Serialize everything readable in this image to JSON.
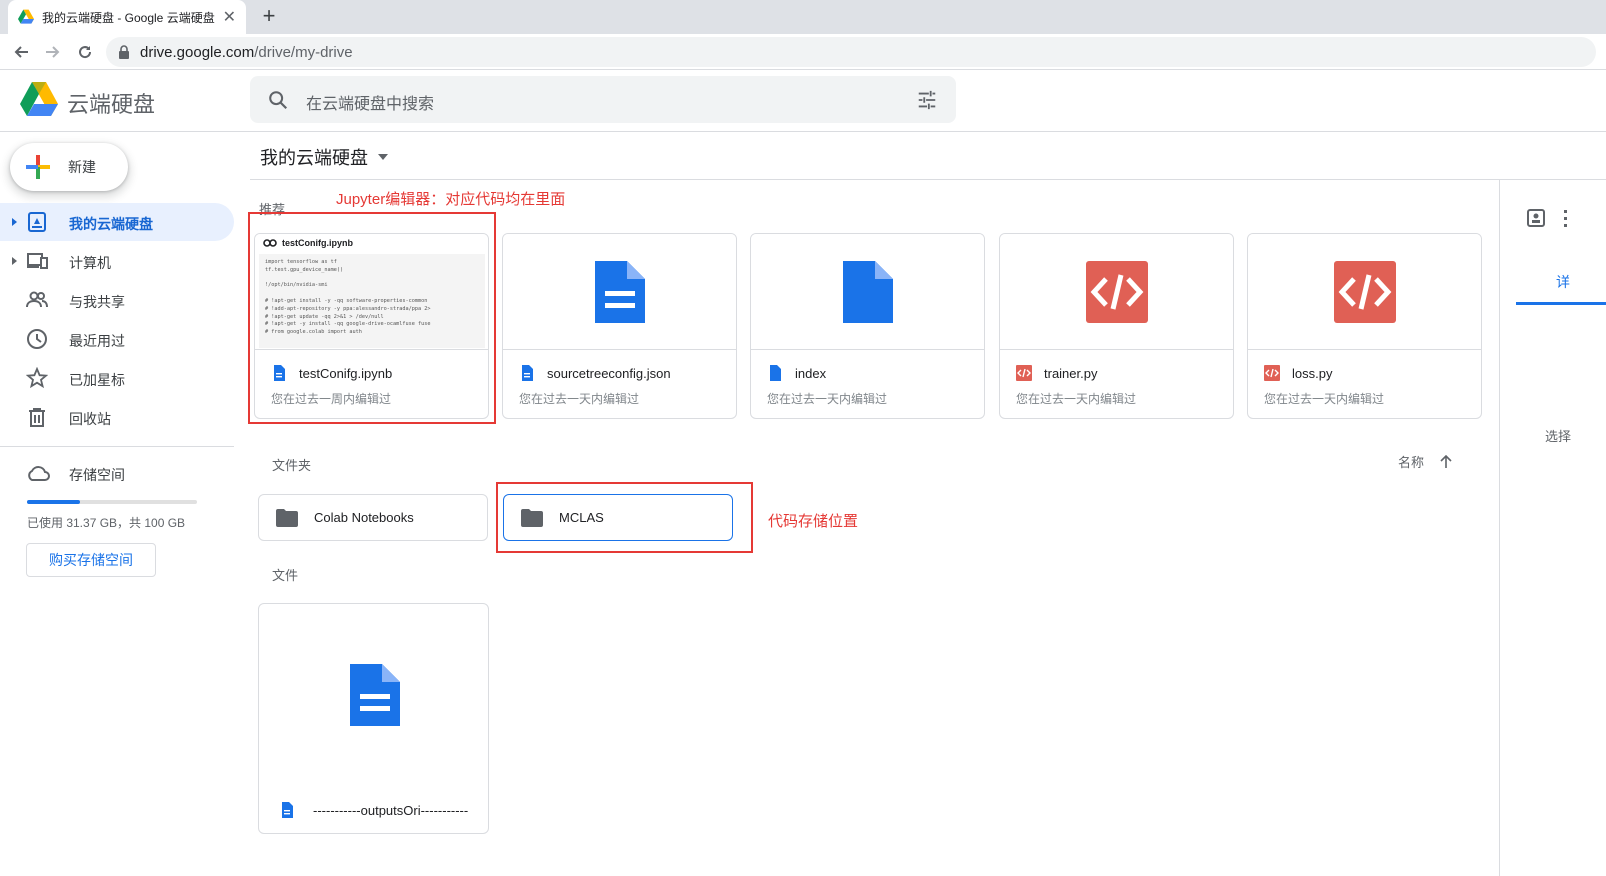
{
  "browser": {
    "tab_title": "我的云端硬盘 - Google 云端硬盘",
    "new_tab": "+",
    "close": "✕",
    "url_host": "drive.google.com",
    "url_path": "/drive/my-drive"
  },
  "header": {
    "brand": "云端硬盘",
    "search_placeholder": "在云端硬盘中搜索"
  },
  "sidebar": {
    "new_label": "新建",
    "items": [
      {
        "label": "我的云端硬盘",
        "icon": "my-drive-icon",
        "active": true
      },
      {
        "label": "计算机",
        "icon": "computer-icon"
      },
      {
        "label": "与我共享",
        "icon": "shared-icon"
      },
      {
        "label": "最近用过",
        "icon": "recent-icon"
      },
      {
        "label": "已加星标",
        "icon": "star-icon"
      },
      {
        "label": "回收站",
        "icon": "trash-icon"
      }
    ],
    "storage_label": "存储空间",
    "storage_used": "已使用 31.37 GB，共 100 GB",
    "storage_fraction": 0.3137,
    "buy_label": "购买存储空间"
  },
  "main": {
    "breadcrumb": "我的云端硬盘",
    "suggested_label": "推荐",
    "notebook_header": "testConifg.ipynb",
    "notebook_code": "import tensorflow as tf\ntf.test.gpu_device_name()\n\n!/opt/bin/nvidia-smi\n\n# !apt-get install -y -qq software-properties-common\n# !add-apt-repository -y ppa:alessandro-strada/ppa 2>\n# !apt-get update -qq 2>&1 > /dev/null\n# !apt-get -y install -qq google-drive-ocamlfuse fuse\n# from google.colab import auth",
    "suggested": [
      {
        "name": "testConifg.ipynb",
        "sub": "您在过去一周内编辑过",
        "type": "doc"
      },
      {
        "name": "sourcetreeconfig.json",
        "sub": "您在过去一天内编辑过",
        "type": "doc"
      },
      {
        "name": "index",
        "sub": "您在过去一天内编辑过",
        "type": "file"
      },
      {
        "name": "trainer.py",
        "sub": "您在过去一天内编辑过",
        "type": "code"
      },
      {
        "name": "loss.py",
        "sub": "您在过去一天内编辑过",
        "type": "code"
      }
    ],
    "folders_label": "文件夹",
    "sort_label": "名称",
    "folders": [
      {
        "name": "Colab Notebooks"
      },
      {
        "name": "MCLAS"
      }
    ],
    "files_label": "文件",
    "files": [
      {
        "name": "-----------outputsOri-----------"
      }
    ]
  },
  "annotations": {
    "jupyter": "Jupyter编辑器：对应代码均在里面",
    "storage": "代码存储位置"
  },
  "right_panel": {
    "tab_partial": "详",
    "hint_partial": "选择"
  },
  "colors": {
    "accent": "#1a73e8",
    "active_bg": "#e8f0fe",
    "doc_blue": "#1a73e8",
    "code_red": "#e06055",
    "annotation_red": "#e53935"
  }
}
